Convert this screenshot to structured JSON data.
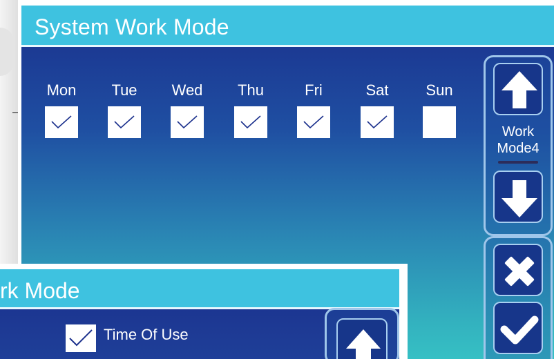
{
  "main_screen": {
    "title": "System Work Mode",
    "days": [
      {
        "label": "Mon",
        "checked": true
      },
      {
        "label": "Tue",
        "checked": true
      },
      {
        "label": "Wed",
        "checked": true
      },
      {
        "label": "Thu",
        "checked": true
      },
      {
        "label": "Fri",
        "checked": true
      },
      {
        "label": "Sat",
        "checked": true
      },
      {
        "label": "Sun",
        "checked": false
      }
    ],
    "side_panel": {
      "up_icon": "arrow-up-icon",
      "mode_line1": "Work",
      "mode_line2": "Mode4",
      "down_icon": "arrow-down-icon",
      "cancel_icon": "close-icon",
      "confirm_icon": "check-icon"
    }
  },
  "overlay_screen": {
    "title_fragment": "rk Mode",
    "time_of_use_label": "Time Of Use",
    "time_of_use_checked": true,
    "up_icon": "arrow-up-icon"
  },
  "colors": {
    "title_bar": "#3ec2e0",
    "panel_top": "#1a2f8c",
    "panel_bottom": "#36c0c4",
    "button_fill": "#17368a",
    "button_border": "#a8cff0",
    "check_stroke": "#1a2f8c"
  }
}
